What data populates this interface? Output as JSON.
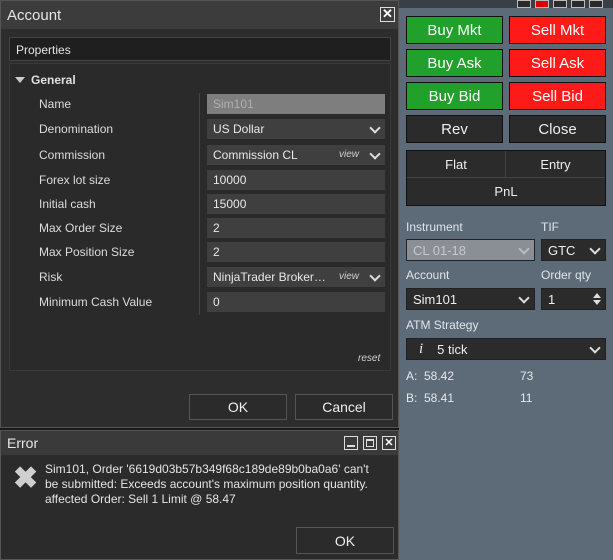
{
  "order_panel": {
    "buy_mkt": "Buy Mkt",
    "sell_mkt": "Sell Mkt",
    "buy_ask": "Buy Ask",
    "sell_ask": "Sell Ask",
    "buy_bid": "Buy Bid",
    "sell_bid": "Sell Bid",
    "rev": "Rev",
    "close": "Close",
    "flat": "Flat",
    "entry": "Entry",
    "pnl": "PnL",
    "instrument_label": "Instrument",
    "instrument_value": "CL 01-18",
    "tif_label": "TIF",
    "tif_value": "GTC",
    "account_label": "Account",
    "account_value": "Sim101",
    "order_qty_label": "Order qty",
    "order_qty_value": "1",
    "atm_label": "ATM Strategy",
    "atm_icon": "i",
    "atm_value": "5 tick",
    "ask_label": "A:",
    "ask_price": "58.42",
    "ask_size": "73",
    "bid_label": "B:",
    "bid_price": "58.41",
    "bid_size": "11",
    "colors": {
      "green": "#22a02c",
      "red": "#ff1a1a"
    }
  },
  "account_dialog": {
    "title": "Account",
    "section": "Properties",
    "group": "General",
    "rows": [
      {
        "label": "Name",
        "value": "Sim101"
      },
      {
        "label": "Denomination",
        "value": "US Dollar"
      },
      {
        "label": "Commission",
        "value": "Commission CL",
        "extra": "view"
      },
      {
        "label": "Forex lot size",
        "value": "10000"
      },
      {
        "label": "Initial cash",
        "value": "15000"
      },
      {
        "label": "Max Order Size",
        "value": "2"
      },
      {
        "label": "Max Position Size",
        "value": "2"
      },
      {
        "label": "Risk",
        "value": "NinjaTrader Broker…",
        "extra": "view"
      },
      {
        "label": "Minimum Cash Value",
        "value": "0"
      }
    ],
    "reset": "reset",
    "ok": "OK",
    "cancel": "Cancel"
  },
  "error_dialog": {
    "title": "Error",
    "message": "Sim101, Order '6619d03b57b349f68c189de89b0ba0a6' can't be submitted: Exceeds account's maximum position quantity. affected Order: Sell 1 Limit @ 58.47",
    "ok": "OK"
  }
}
